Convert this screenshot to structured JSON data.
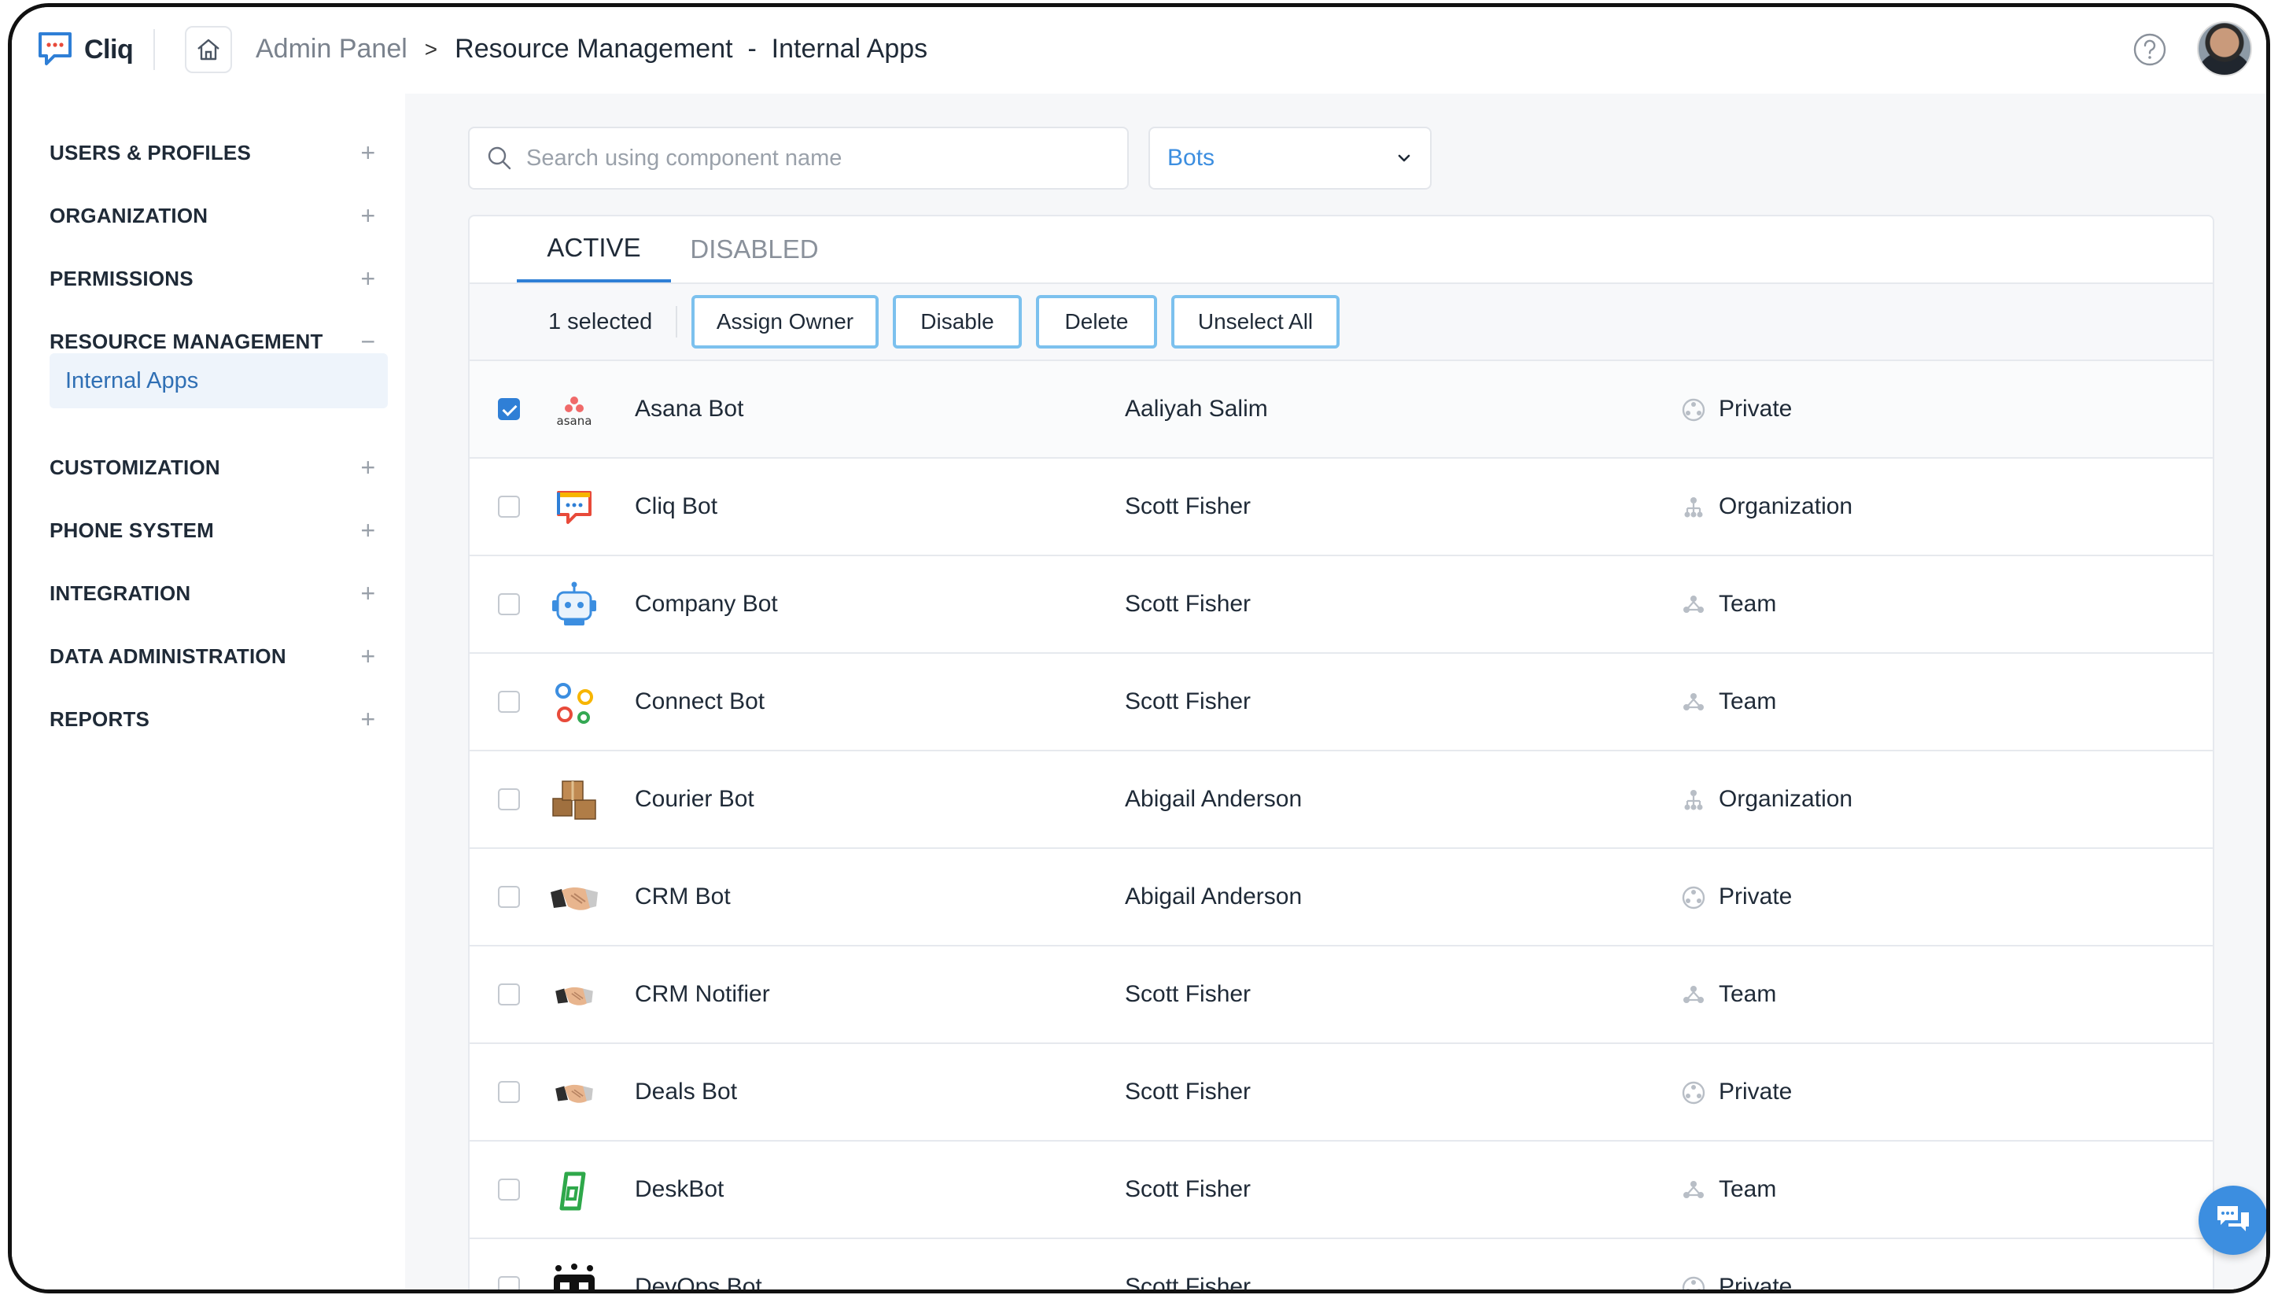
{
  "app": {
    "name": "Cliq"
  },
  "breadcrumb": {
    "root": "Admin Panel",
    "separator": ">",
    "current": "Resource Management  -  Internal Apps"
  },
  "sidebar": {
    "items": [
      {
        "label": "USERS & PROFILES",
        "toggle": "+"
      },
      {
        "label": "ORGANIZATION",
        "toggle": "+"
      },
      {
        "label": "PERMISSIONS",
        "toggle": "+"
      },
      {
        "label": "RESOURCE MANAGEMENT",
        "toggle": "−"
      },
      {
        "label": "CUSTOMIZATION",
        "toggle": "+"
      },
      {
        "label": "PHONE SYSTEM",
        "toggle": "+"
      },
      {
        "label": "INTEGRATION",
        "toggle": "+"
      },
      {
        "label": "DATA ADMINISTRATION",
        "toggle": "+"
      },
      {
        "label": "REPORTS",
        "toggle": "+"
      }
    ],
    "active_sub": "Internal Apps"
  },
  "search": {
    "placeholder": "Search using component name",
    "value": ""
  },
  "filter": {
    "selected": "Bots"
  },
  "tabs": [
    {
      "label": "ACTIVE"
    },
    {
      "label": "DISABLED"
    }
  ],
  "actions": {
    "selected_count": "1 selected",
    "buttons": [
      "Assign Owner",
      "Disable",
      "Delete",
      "Unselect All"
    ]
  },
  "rows": [
    {
      "name": "Asana Bot",
      "owner": "Aaliyah Salim",
      "scope": "Private",
      "checked": true,
      "icon": "asana-icon"
    },
    {
      "name": "Cliq Bot",
      "owner": "Scott Fisher",
      "scope": "Organization",
      "checked": false,
      "icon": "cliq-icon"
    },
    {
      "name": "Company Bot",
      "owner": "Scott Fisher",
      "scope": "Team",
      "checked": false,
      "icon": "robot-icon"
    },
    {
      "name": "Connect Bot",
      "owner": "Scott Fisher",
      "scope": "Team",
      "checked": false,
      "icon": "connect-icon"
    },
    {
      "name": "Courier Bot",
      "owner": "Abigail Anderson",
      "scope": "Organization",
      "checked": false,
      "icon": "boxes-icon"
    },
    {
      "name": "CRM Bot",
      "owner": "Abigail Anderson",
      "scope": "Private",
      "checked": false,
      "icon": "handshake-icon"
    },
    {
      "name": "CRM Notifier",
      "owner": "Scott Fisher",
      "scope": "Team",
      "checked": false,
      "icon": "handshake-icon"
    },
    {
      "name": "Deals Bot",
      "owner": "Scott Fisher",
      "scope": "Private",
      "checked": false,
      "icon": "handshake-icon"
    },
    {
      "name": "DeskBot",
      "owner": "Scott Fisher",
      "scope": "Team",
      "checked": false,
      "icon": "desk-icon"
    },
    {
      "name": "DevOps Bot",
      "owner": "Scott Fisher",
      "scope": "Private",
      "checked": false,
      "icon": "devops-robot-icon"
    }
  ],
  "colors": {
    "accent": "#2f7fd6",
    "link": "#3c8ee0",
    "button_border": "#7cc1ee"
  }
}
